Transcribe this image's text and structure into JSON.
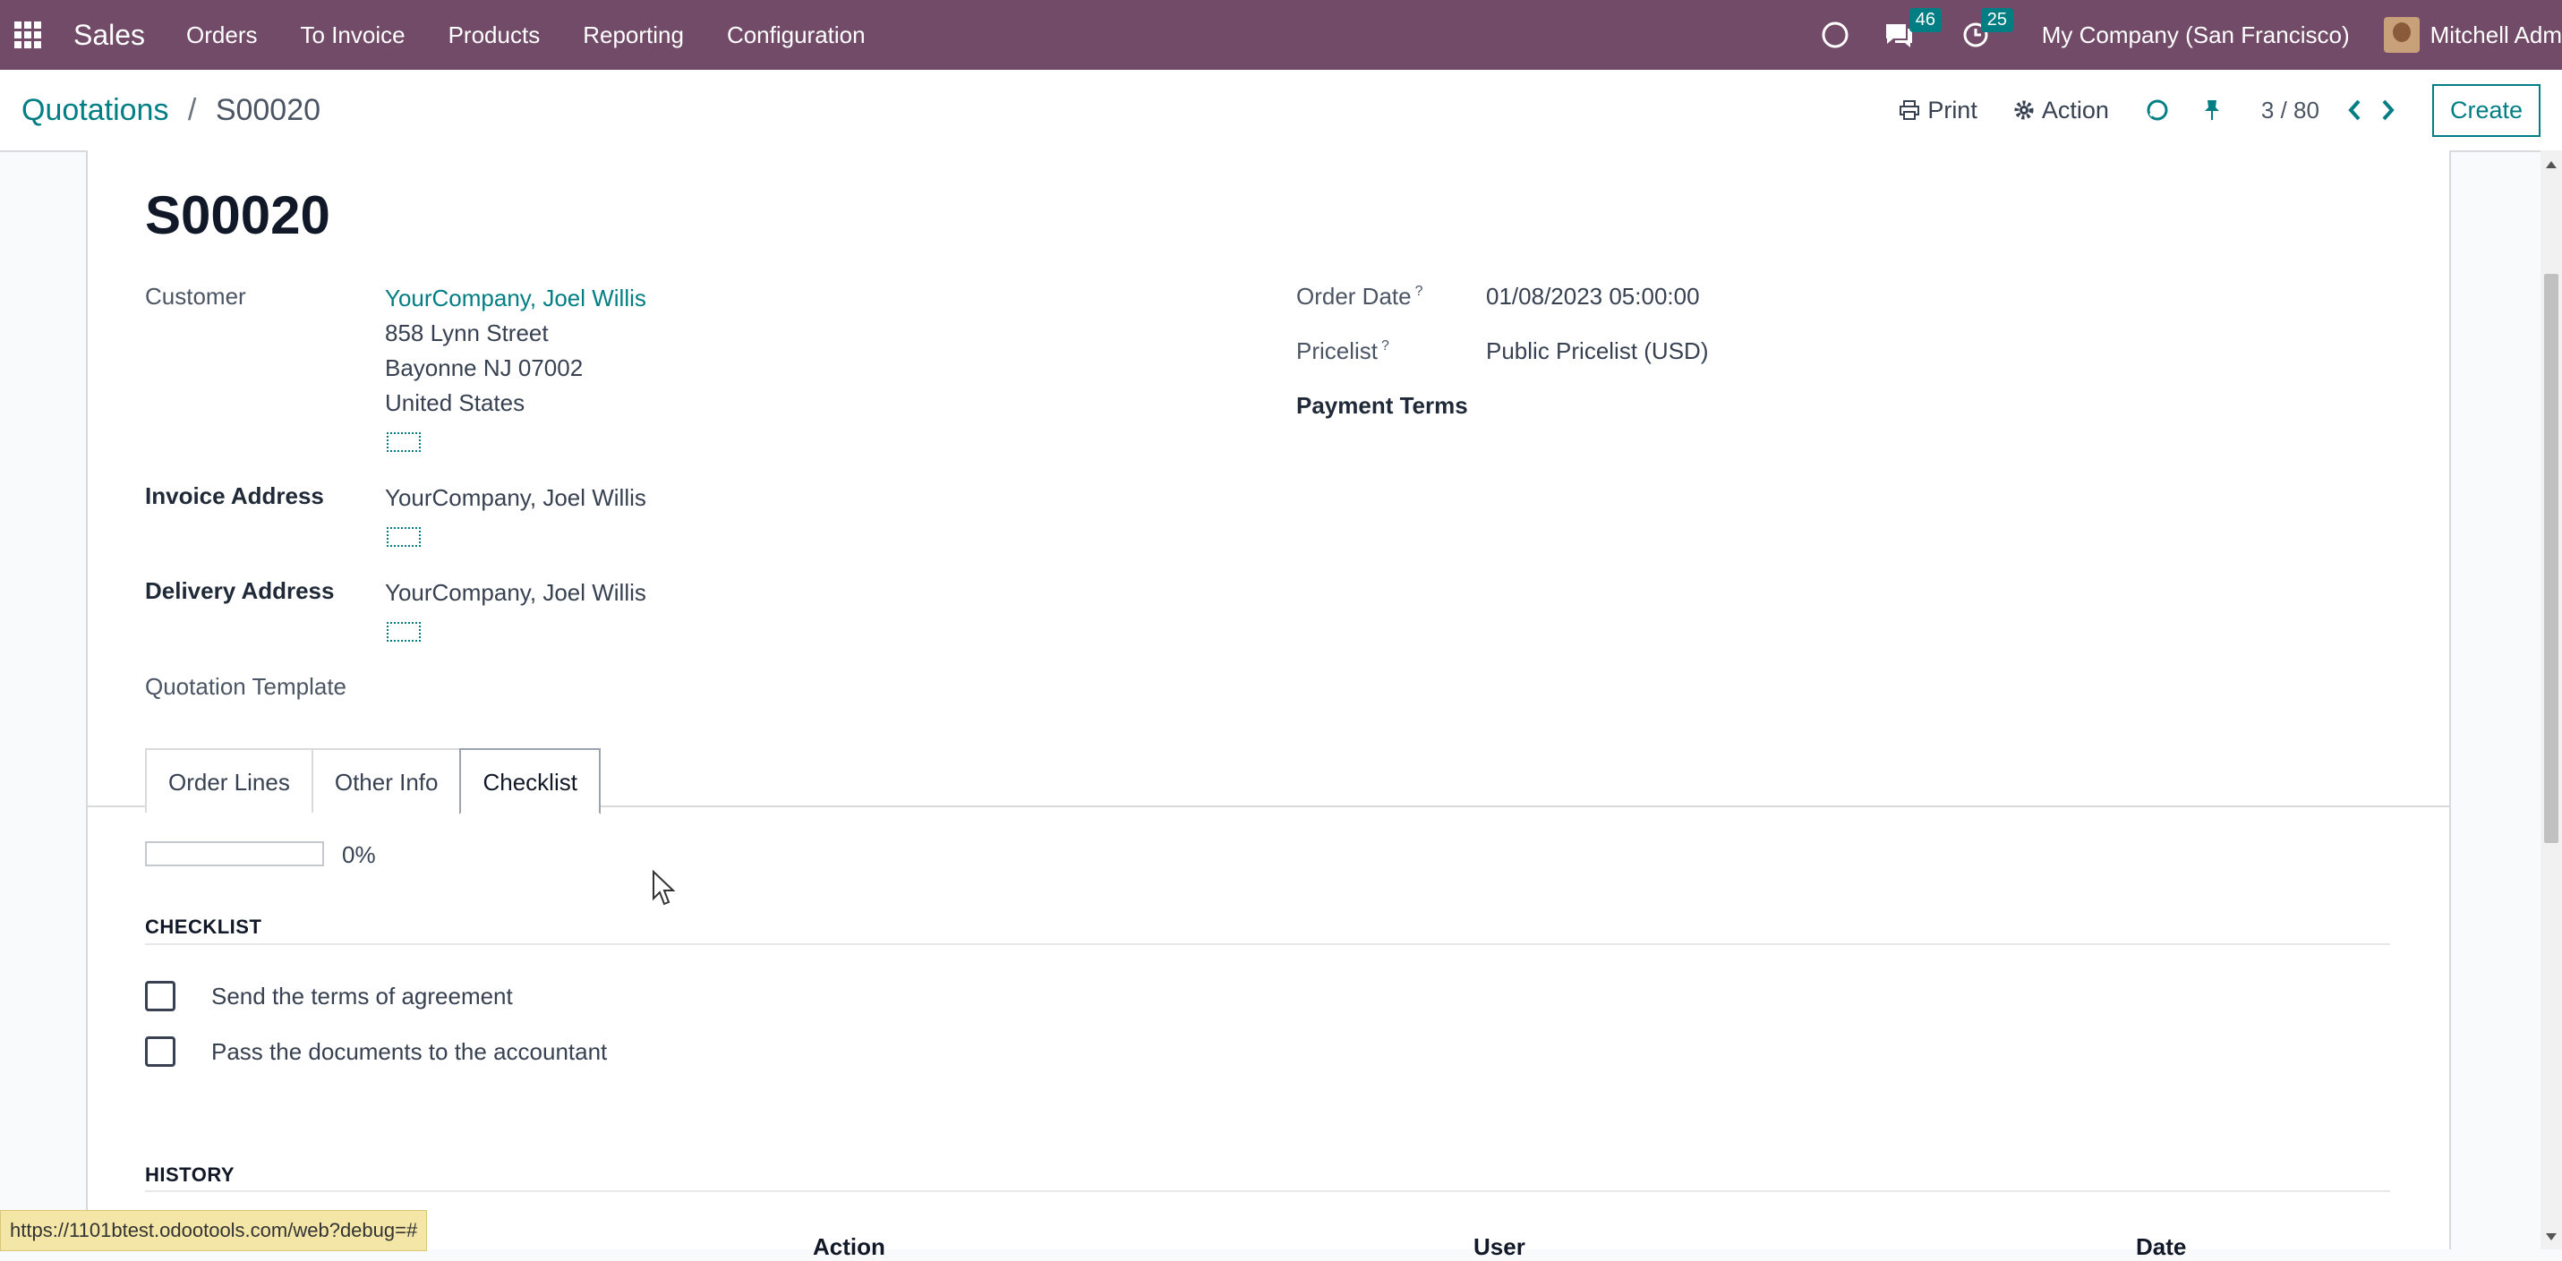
{
  "topbar": {
    "app_name": "Sales",
    "menu": [
      "Orders",
      "To Invoice",
      "Products",
      "Reporting",
      "Configuration"
    ],
    "messages_count": "46",
    "activities_count": "25",
    "company": "My Company (San Francisco)",
    "user": "Mitchell Adm"
  },
  "control_panel": {
    "breadcrumb_parent": "Quotations",
    "breadcrumb_separator": "/",
    "breadcrumb_current": "S00020",
    "print_label": "Print",
    "action_label": "Action",
    "pager": "3 / 80",
    "create_label": "Create"
  },
  "record": {
    "name": "S00020",
    "customer_label": "Customer",
    "customer_name": "YourCompany, Joel Willis",
    "address_line1": "858 Lynn Street",
    "address_line2": "Bayonne NJ 07002",
    "address_line3": "United States",
    "invoice_address_label": "Invoice Address",
    "invoice_address": "YourCompany, Joel Willis",
    "delivery_address_label": "Delivery Address",
    "delivery_address": "YourCompany, Joel Willis",
    "quotation_template_label": "Quotation Template",
    "order_date_label": "Order Date",
    "order_date": "01/08/2023 05:00:00",
    "pricelist_label": "Pricelist",
    "pricelist": "Public Pricelist (USD)",
    "payment_terms_label": "Payment Terms",
    "help_mark": "?"
  },
  "tabs": [
    {
      "label": "Order Lines"
    },
    {
      "label": "Other Info"
    },
    {
      "label": "Checklist"
    }
  ],
  "checklist": {
    "progress_fraction": 0,
    "progress_text": "0%",
    "section_title": "CHECKLIST",
    "items": [
      {
        "label": "Send the terms of agreement",
        "checked": false
      },
      {
        "label": "Pass the documents to the accountant",
        "checked": false
      }
    ],
    "history_title": "HISTORY",
    "history_columns": [
      "Action",
      "User",
      "Date"
    ]
  },
  "status_url": "https://1101btest.odootools.com/web?debug=#",
  "colors": {
    "nav": "#714b67",
    "accent": "#017e84"
  }
}
